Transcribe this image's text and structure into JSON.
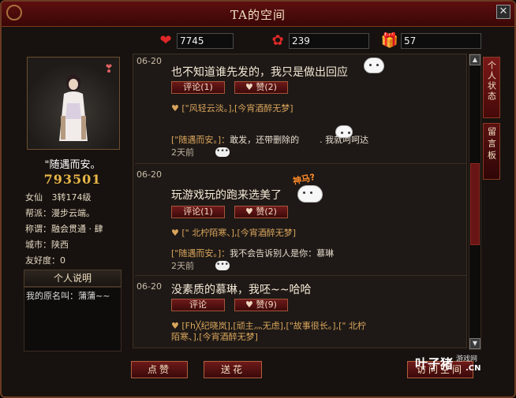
{
  "window": {
    "title": "TA的空间"
  },
  "stats": {
    "hearts": "7745",
    "flowers": "239",
    "gifts": "57"
  },
  "profile": {
    "nickname": "\"随遇而安。",
    "score": "793501",
    "class_label": "女仙",
    "level": "3转174级",
    "faction": "帮派：漫步云端。",
    "title": "称谓：融会贯通 · 肆",
    "city": "城市：陕西",
    "friendship": "友好度：0",
    "desc_title": "个人说明",
    "desc_text": "我的原名叫：蒲蒲~~"
  },
  "side_tabs": [
    "个人状态",
    "留言板"
  ],
  "entries": [
    {
      "date": "06-20",
      "text": "也不知道谁先发的，我只是做出回应",
      "comment_btn": "评论(1)",
      "like_btn": "赞(2)",
      "likes": "[\"风轻云淡。],[今宵酒醉无梦]",
      "comment_author": "[\"随遇而安。]：",
      "comment_text": "敢发，还带删除的",
      "comment_tail": ". 我就呵呵达",
      "time_ago": "2天前"
    },
    {
      "date": "06-20",
      "text": "玩游戏玩的跑来选美了",
      "emoji_label": "神马?",
      "comment_btn": "评论(1)",
      "like_btn": "赞(2)",
      "likes": "[\" 北柠陌寒、],[今宵酒醉无梦]",
      "comment_author": "[\"随遇而安。]：",
      "comment_text": "我不会告诉别人是你：慕琳",
      "time_ago": "2天前"
    },
    {
      "date": "06-20",
      "text": "没素质的慕琳，我呸~~哈哈",
      "comment_btn": "评论",
      "like_btn": "赞(9)",
      "likes_line1": "[Fh╳纪晓岚],[顽主灬无虑],[\"故事很长。],[\" 北柠",
      "likes_line2": "陌寒、],[今宵酒醉无梦]"
    }
  ],
  "bottom_buttons": {
    "like": "点赞",
    "flower": "送花",
    "visit": "访问空间"
  },
  "watermark": {
    "main": "叶子猪",
    "sub": "游戏网",
    "cn": ".CN"
  },
  "colors": {
    "title_bg": "#5e0f0f",
    "accent_gold": "#e8b648",
    "likes_text": "#d9a55c"
  }
}
